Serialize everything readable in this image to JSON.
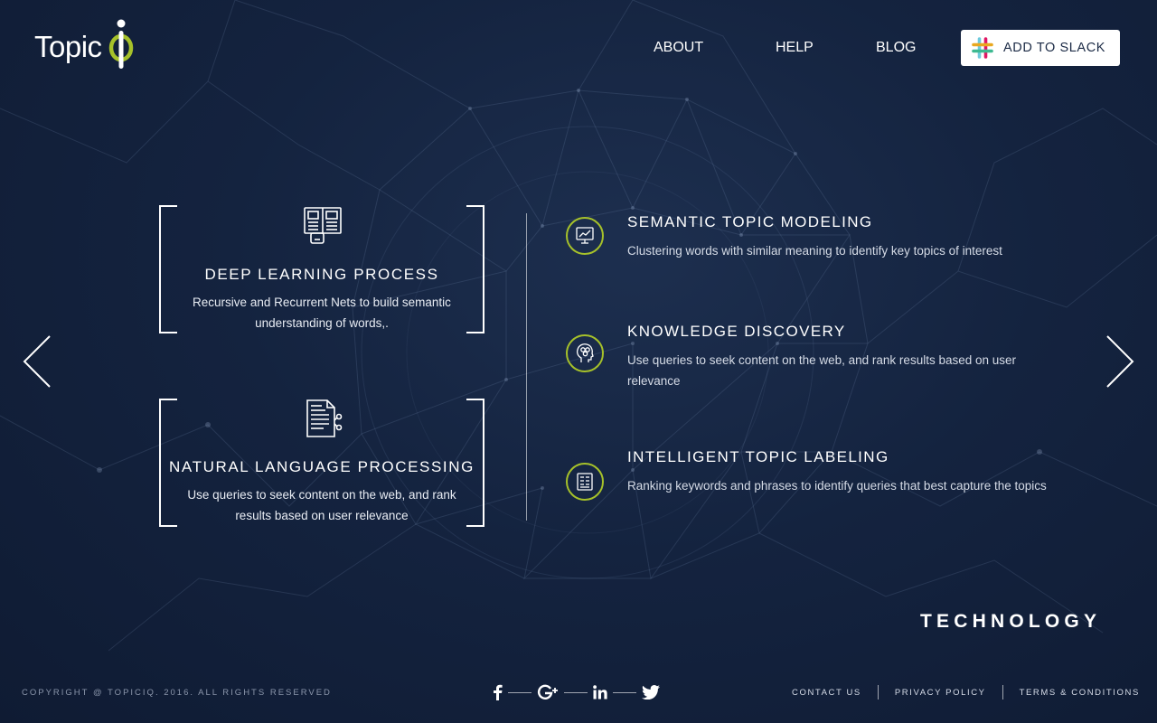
{
  "brand": {
    "logo_text": "Topic",
    "accent_color": "#a6c12a"
  },
  "nav": {
    "about": "ABOUT",
    "help": "HELP",
    "blog": "BLOG",
    "slack_button": "ADD TO SLACK"
  },
  "cards": [
    {
      "title": "DEEP LEARNING PROCESS",
      "description": "Recursive and Recurrent Nets to build semantic understanding of words,.",
      "icon": "newspaper-icon"
    },
    {
      "title": "NATURAL LANGUAGE PROCESSING",
      "description": "Use queries to seek content on the web, and rank results based on user relevance",
      "icon": "document-network-icon"
    }
  ],
  "features": [
    {
      "title": "SEMANTIC TOPIC MODELING",
      "description": "Clustering words with similar meaning to identify key topics of interest",
      "icon": "chart-monitor-icon"
    },
    {
      "title": "KNOWLEDGE DISCOVERY",
      "description": "Use queries to seek content on the web, and rank results based on user relevance",
      "icon": "head-gears-icon"
    },
    {
      "title": "INTELLIGENT TOPIC LABELING",
      "description": "Ranking keywords and phrases to identify queries that best capture the topics",
      "icon": "document-list-icon"
    }
  ],
  "section_label": "TECHNOLOGY",
  "footer": {
    "copyright": "COPYRIGHT @ TOPICIQ. 2016. ALL RIGHTS RESERVED",
    "social": [
      "facebook-icon",
      "google-plus-icon",
      "linkedin-icon",
      "twitter-icon"
    ],
    "links": {
      "contact": "CONTACT US",
      "privacy": "PRIVACY POLICY",
      "terms": "TERMS & CONDITIONS"
    }
  }
}
